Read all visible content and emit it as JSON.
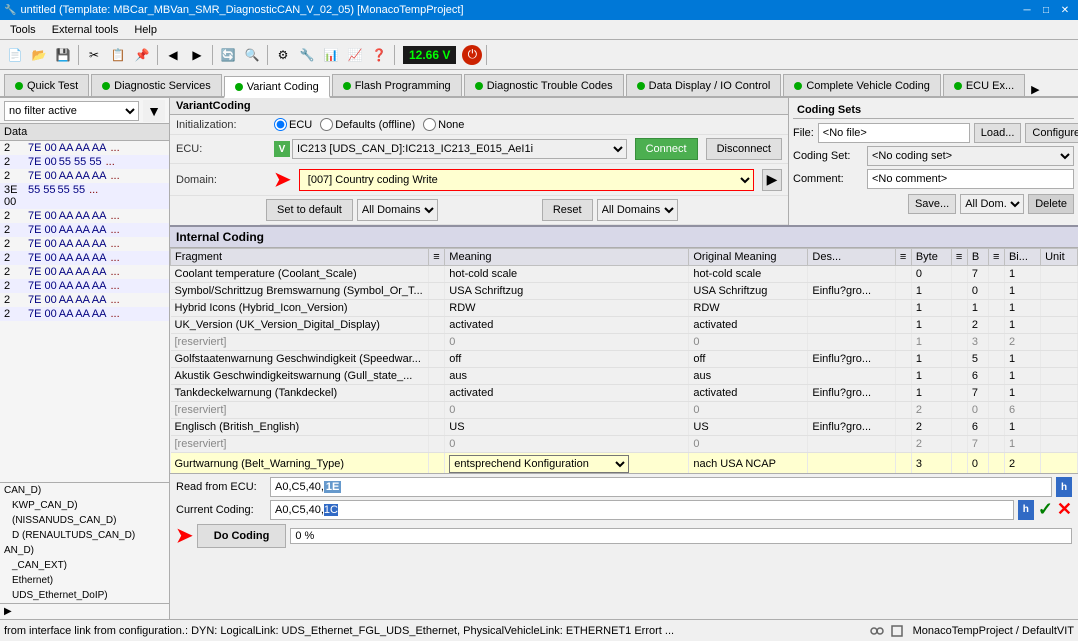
{
  "titlebar": {
    "title": "untitled (Template: MBCar_MBVan_SMR_DiagnosticCAN_V_02_05) [MonacoTempProject]",
    "min": "─",
    "max": "□",
    "close": "✕"
  },
  "menubar": {
    "items": [
      "Tools",
      "External tools",
      "Help"
    ]
  },
  "toolbar": {
    "voltage": "12.66 V"
  },
  "tabs": [
    {
      "label": "Quick Test",
      "color": "#00aa00",
      "active": false
    },
    {
      "label": "Diagnostic Services",
      "color": "#00aa00",
      "active": false
    },
    {
      "label": "Variant Coding",
      "color": "#00aa00",
      "active": true
    },
    {
      "label": "Flash Programming",
      "color": "#00aa00",
      "active": false
    },
    {
      "label": "Diagnostic Trouble Codes",
      "color": "#00aa00",
      "active": false
    },
    {
      "label": "Data Display / IO Control",
      "color": "#00aa00",
      "active": false
    },
    {
      "label": "Complete Vehicle Coding",
      "color": "#00aa00",
      "active": false
    },
    {
      "label": "ECU Ex...",
      "color": "#00aa00",
      "active": false
    }
  ],
  "left_panel": {
    "filter_placeholder": "no filter active",
    "data_rows": [
      {
        "addr": "2",
        "bytes": "7E 00",
        "hex": "AA AA AA",
        "dots": "..."
      },
      {
        "addr": "2",
        "bytes": "7E 00",
        "hex": "55 55 55",
        "dots": "..."
      },
      {
        "addr": "2",
        "bytes": "7E 00",
        "hex": "AA AA AA",
        "dots": "..."
      },
      {
        "addr": "3E 00",
        "bytes": "55 55",
        "hex": "55 55",
        "dots": "..."
      },
      {
        "addr": "2",
        "bytes": "7E 00",
        "hex": "AA AA AA",
        "dots": "..."
      },
      {
        "addr": "2",
        "bytes": "7E 00",
        "hex": "AA AA AA",
        "dots": "..."
      },
      {
        "addr": "2",
        "bytes": "7E 00",
        "hex": "AA AA AA",
        "dots": "..."
      },
      {
        "addr": "2",
        "bytes": "7E 00",
        "hex": "AA AA AA",
        "dots": "..."
      },
      {
        "addr": "2",
        "bytes": "7E 00",
        "hex": "AA AA AA",
        "dots": "..."
      },
      {
        "addr": "2",
        "bytes": "7E 00",
        "hex": "AA AA AA",
        "dots": "..."
      },
      {
        "addr": "2",
        "bytes": "7E 00",
        "hex": "AA AA AA",
        "dots": "..."
      },
      {
        "addr": "2",
        "bytes": "7E 00",
        "hex": "AA AA AA",
        "dots": "..."
      }
    ],
    "can_items": [
      {
        "label": "CAN_D)",
        "indent": 0
      },
      {
        "label": "KWP_CAN_D)",
        "indent": 1
      },
      {
        "label": "(NISSANUDS_CAN_D)",
        "indent": 1
      },
      {
        "label": "D (RENAULTUDS_CAN_D)",
        "indent": 1
      },
      {
        "label": "AN_D)",
        "indent": 0
      },
      {
        "label": "_CAN_EXT)",
        "indent": 1
      },
      {
        "label": "Ethernet)",
        "indent": 1
      },
      {
        "label": "UDS_Ethernet_DoIP)",
        "indent": 1
      }
    ],
    "expand_label": ">"
  },
  "variant_coding": {
    "section_title": "VariantCoding",
    "init_label": "Initialization:",
    "radio_options": [
      "ECU",
      "Defaults (offline)",
      "None"
    ],
    "ecu_label": "ECU:",
    "ecu_value": "IC213 [UDS_CAN_D]:IC213_IC213_E015_AeI1i",
    "connect_label": "Connect",
    "disconnect_label": "Disconnect",
    "domain_label": "Domain:",
    "domain_value": "[007] Country coding Write",
    "set_default_label": "Set to default",
    "all_domains_label": "All Domains",
    "reset_label": "Reset",
    "all_domains2_label": "All Domains"
  },
  "coding_sets": {
    "title": "Coding Sets",
    "file_label": "File:",
    "file_value": "<No file>",
    "load_label": "Load...",
    "configure_label": "Configure...",
    "coding_set_label": "Coding Set:",
    "coding_set_value": "<No coding set>",
    "comment_label": "Comment:",
    "comment_value": "<No comment>",
    "save_label": "Save...",
    "all_dom_label": "All Dom.",
    "delete_label": "Delete"
  },
  "internal_coding": {
    "title": "Internal Coding",
    "columns": [
      "Fragment",
      "",
      "Meaning",
      "Original Meaning",
      "Des...",
      "",
      "Byte",
      "",
      "B",
      "",
      "Bi...",
      "Unit"
    ],
    "rows": [
      {
        "fragment": "Coolant temperature (Coolant_Scale)",
        "meaning": "hot-cold scale",
        "original": "hot-cold scale",
        "des": "",
        "byte": "0",
        "b": "7",
        "bi": "1",
        "unit": "",
        "selected": false
      },
      {
        "fragment": "Symbol/Schrittzug Bremswarnung (Symbol_Or_T...",
        "meaning": "USA Schriftzug",
        "original": "USA Schriftzug",
        "des": "Einflu?gro...",
        "byte": "1",
        "b": "0",
        "bi": "1",
        "unit": "",
        "selected": false
      },
      {
        "fragment": "Hybrid Icons (Hybrid_Icon_Version)",
        "meaning": "RDW",
        "original": "RDW",
        "des": "",
        "byte": "1",
        "b": "1",
        "bi": "1",
        "unit": "",
        "selected": false
      },
      {
        "fragment": "UK_Version (UK_Version_Digital_Display)",
        "meaning": "activated",
        "original": "activated",
        "des": "",
        "byte": "1",
        "b": "2",
        "bi": "1",
        "unit": "",
        "selected": false
      },
      {
        "fragment": "[reserviert]",
        "meaning": "0",
        "original": "0",
        "des": "",
        "byte": "1",
        "b": "3",
        "bi": "2",
        "unit": "",
        "selected": false,
        "reserved": true
      },
      {
        "fragment": "Golfstaatenwarnung Geschwindigkeit (Speedwar...",
        "meaning": "off",
        "original": "off",
        "des": "Einflu?gro...",
        "byte": "1",
        "b": "5",
        "bi": "1",
        "unit": "",
        "selected": false
      },
      {
        "fragment": "Akustik Geschwindigkeitswarnung (Gull_state_...",
        "meaning": "aus",
        "original": "aus",
        "des": "",
        "byte": "1",
        "b": "6",
        "bi": "1",
        "unit": "",
        "selected": false
      },
      {
        "fragment": "Tankdeckelwarnung (Tankdeckel)",
        "meaning": "activated",
        "original": "activated",
        "des": "Einflu?gro...",
        "byte": "1",
        "b": "7",
        "bi": "1",
        "unit": "",
        "selected": false
      },
      {
        "fragment": "[reserviert]",
        "meaning": "0",
        "original": "0",
        "des": "",
        "byte": "2",
        "b": "0",
        "bi": "6",
        "unit": "",
        "selected": false,
        "reserved": true
      },
      {
        "fragment": "Englisch (British_English)",
        "meaning": "US",
        "original": "US",
        "des": "Einflu?gro...",
        "byte": "2",
        "b": "6",
        "bi": "1",
        "unit": "",
        "selected": false
      },
      {
        "fragment": "[reserviert]",
        "meaning": "0",
        "original": "0",
        "des": "",
        "byte": "2",
        "b": "7",
        "bi": "1",
        "unit": "",
        "selected": false,
        "reserved": true
      },
      {
        "fragment": "Gurtwarnung (Belt_Warning_Type)",
        "meaning": "entsprechend Konfiguration",
        "original": "nach USA NCAP",
        "des": "",
        "byte": "3",
        "b": "0",
        "bi": "2",
        "unit": "",
        "selected": true,
        "editing": true
      }
    ]
  },
  "bottom": {
    "read_from_ecu_label": "Read from ECU:",
    "read_from_ecu_value": "A0,C5,40,1E",
    "read_highlight": "1E",
    "current_coding_label": "Current Coding:",
    "current_coding_value": "A0,C5,40,1C",
    "current_highlight": "1C",
    "h_label": "h",
    "do_coding_label": "Do Coding",
    "progress_text": "0 %",
    "tick": "✓",
    "cross": "✕"
  },
  "statusbar": {
    "text": "from interface link from configuration.: DYN: LogicalLink: UDS_Ethernet_FGL_UDS_Ethernet, PhysicalVehicleLink: ETHERNET1 Errort ...",
    "project": "MonacoTempProject / DefaultVIT"
  }
}
